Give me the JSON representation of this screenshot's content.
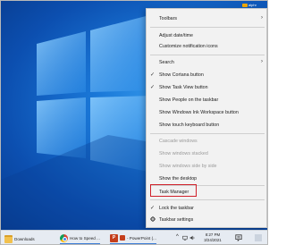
{
  "watermark": {
    "text": "alphr"
  },
  "menu": {
    "items": [
      {
        "label": "Toolbars",
        "submenu": true,
        "checked": false,
        "disabled": false
      },
      {
        "label": "Adjust date/time",
        "checked": false,
        "disabled": false
      },
      {
        "label": "Customize notification icons",
        "checked": false,
        "disabled": false
      },
      {
        "label": "Search",
        "submenu": true,
        "checked": false,
        "disabled": false
      },
      {
        "label": "Show Cortana button",
        "checked": true,
        "disabled": false
      },
      {
        "label": "Show Task View button",
        "checked": true,
        "disabled": false
      },
      {
        "label": "Show People on the taskbar",
        "checked": false,
        "disabled": false
      },
      {
        "label": "Show Windows Ink Workspace button",
        "checked": false,
        "disabled": false
      },
      {
        "label": "Show touch keyboard button",
        "checked": false,
        "disabled": false
      },
      {
        "label": "Cascade windows",
        "checked": false,
        "disabled": true
      },
      {
        "label": "Show windows stacked",
        "checked": false,
        "disabled": true
      },
      {
        "label": "Show windows side by side",
        "checked": false,
        "disabled": true
      },
      {
        "label": "Show the desktop",
        "checked": false,
        "disabled": false
      },
      {
        "label": "Task Manager",
        "checked": false,
        "disabled": false,
        "highlighted": true
      },
      {
        "label": "Lock the taskbar",
        "checked": true,
        "disabled": false
      },
      {
        "label": "Taskbar settings",
        "icon": "gear-icon",
        "checked": false,
        "disabled": false
      }
    ],
    "check_glyph": "✓",
    "arrow_glyph": "›"
  },
  "taskbar": {
    "items": [
      {
        "label": "Downloads",
        "icon": "folder-icon"
      },
      {
        "label": "How to Speed ...",
        "icon": "chrome-icon"
      },
      {
        "label": "- PowerPoint (...",
        "icon": "powerpoint-icon",
        "icon_text": "P"
      }
    ],
    "time": "8:27 PM",
    "date": "3/24/2021",
    "tray_chevron": "^"
  },
  "colors": {
    "highlight_border": "#d0202a",
    "menu_bg": "#f2f2f2",
    "taskbar_bg": "#e6ebf2"
  }
}
